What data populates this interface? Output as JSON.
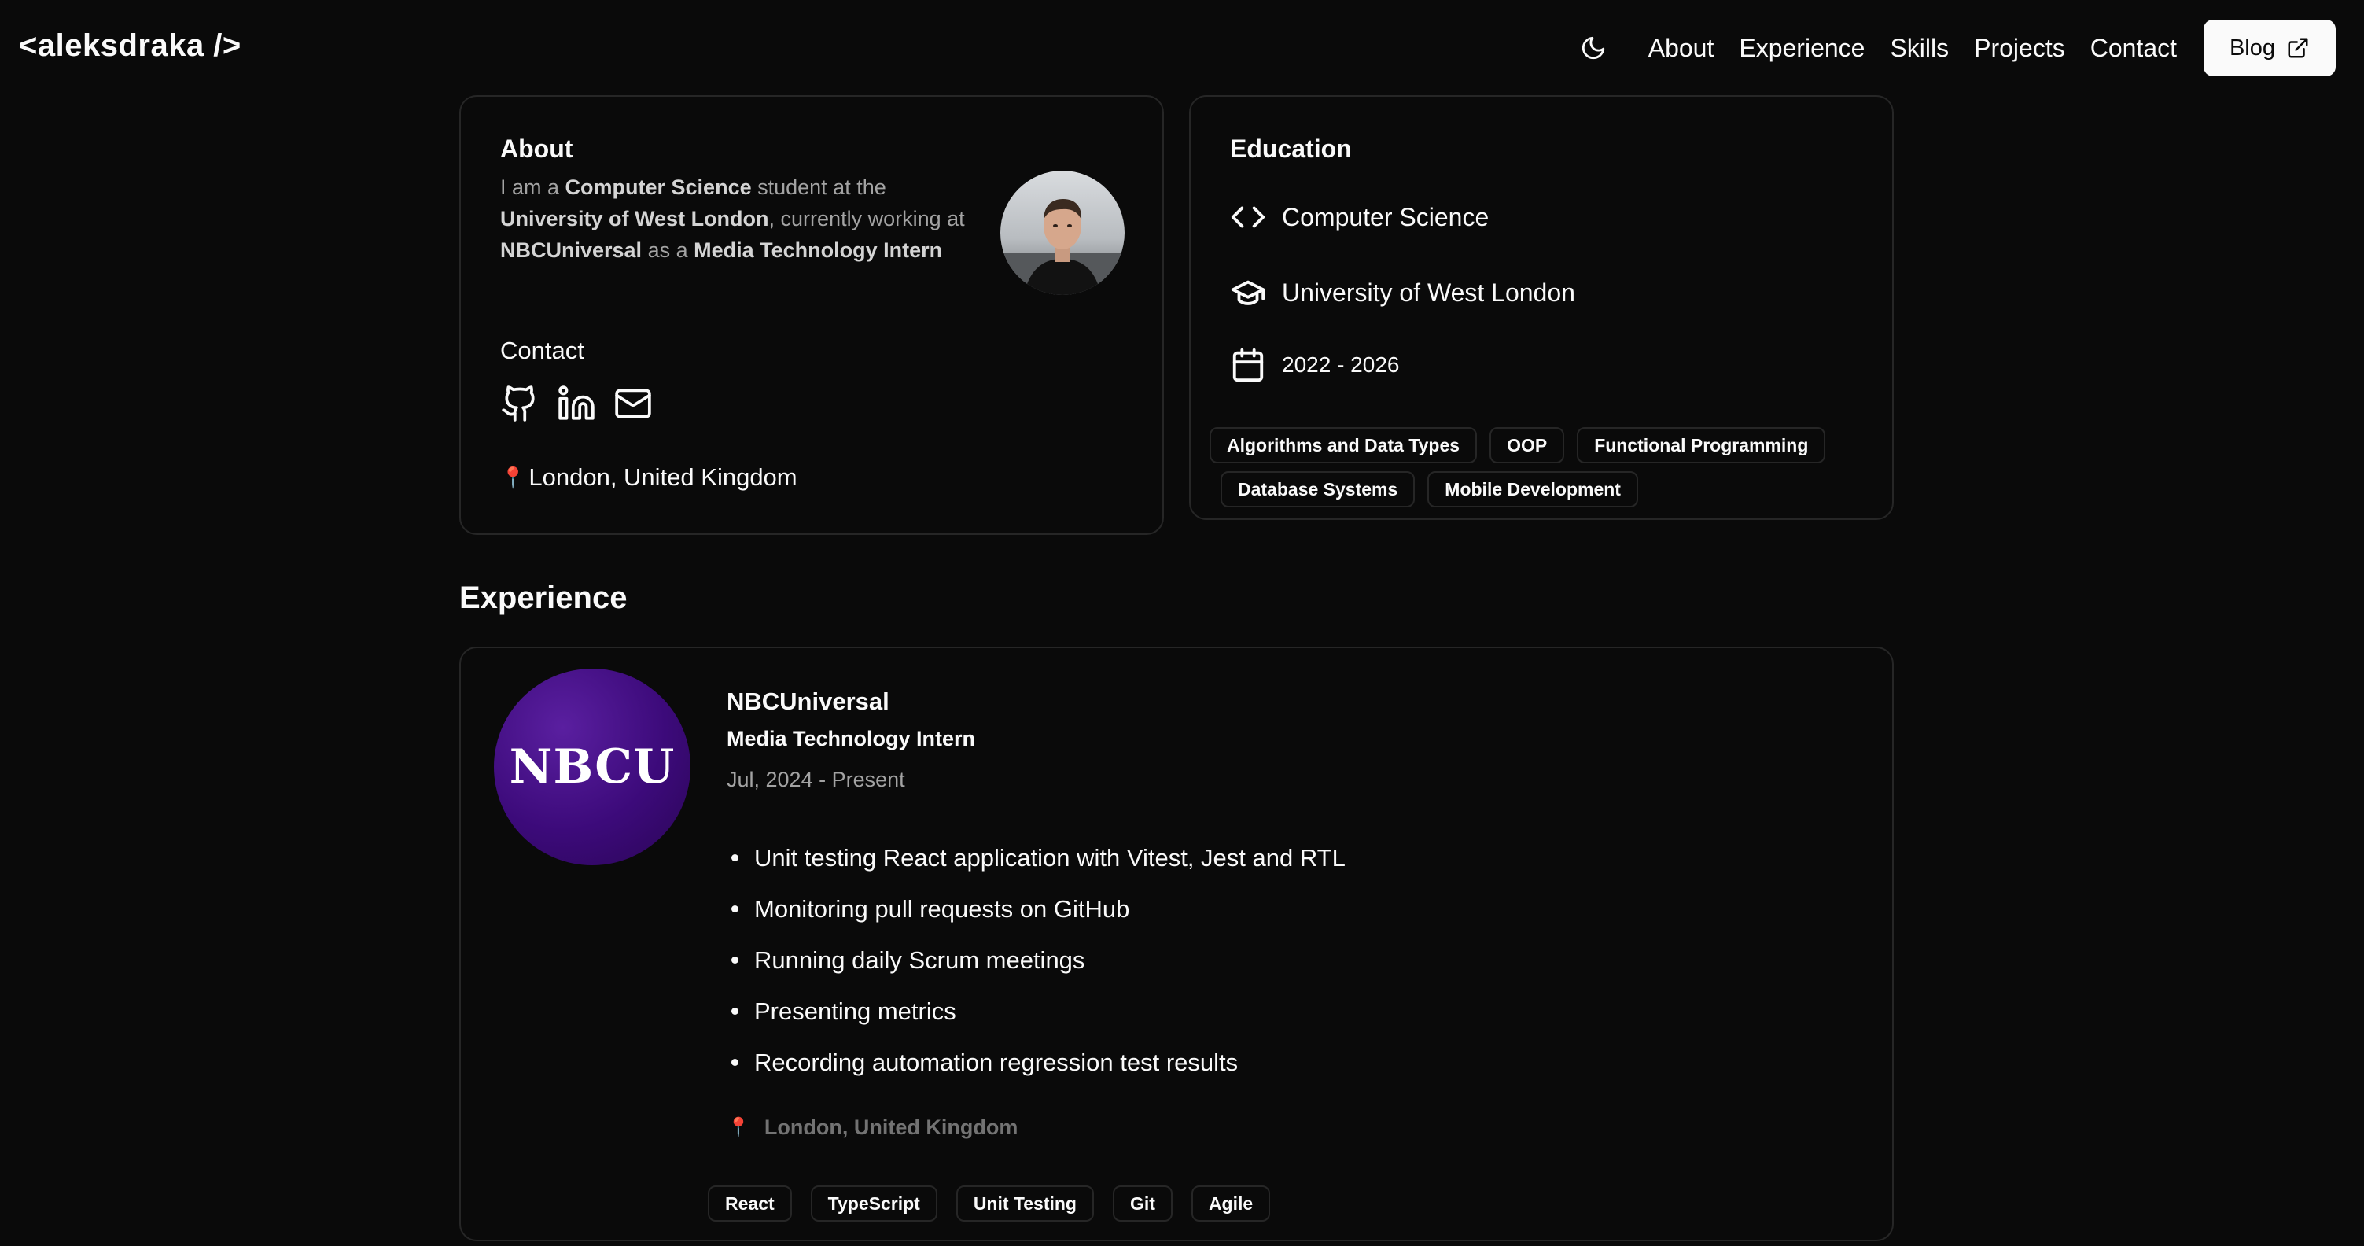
{
  "nav": {
    "logo": "<aleksdraka />",
    "links": [
      "About",
      "Experience",
      "Skills",
      "Projects",
      "Contact"
    ],
    "blog_label": "Blog",
    "theme_icon": "moon-icon"
  },
  "about": {
    "title": "About",
    "text_parts": [
      "I am a ",
      "Computer Science",
      " student at the ",
      "University of West London",
      ", currently working at ",
      "NBCUniversal",
      " as a ",
      "Media Technology Intern"
    ],
    "contact_label": "Contact",
    "contact_icons": [
      "github-icon",
      "linkedin-icon",
      "mail-icon"
    ],
    "location": "London, United Kingdom"
  },
  "education": {
    "title": "Education",
    "degree": "Computer Science",
    "university": "University of West London",
    "years": "2022 - 2026",
    "tags": [
      "Algorithms and Data Types",
      "OOP",
      "Functional Programming",
      "Database Systems",
      "Mobile Development"
    ]
  },
  "experience": {
    "heading": "Experience",
    "company": "NBCUniversal",
    "logo_text": "NBCU",
    "role": "Media Technology Intern",
    "dates": "Jul, 2024 - Present",
    "bullets": [
      "Unit testing React application with Vitest, Jest and RTL",
      "Monitoring pull requests on GitHub",
      "Running daily Scrum meetings",
      "Presenting metrics",
      "Recording automation regression test results"
    ],
    "location": "London, United Kingdom",
    "tags": [
      "React",
      "TypeScript",
      "Unit Testing",
      "Git",
      "Agile"
    ]
  },
  "colors": {
    "background": "#0a0a0a",
    "border": "#262626",
    "text": "#fafafa",
    "muted": "#a3a3a3",
    "brand_purple": "#3c0a7a"
  }
}
